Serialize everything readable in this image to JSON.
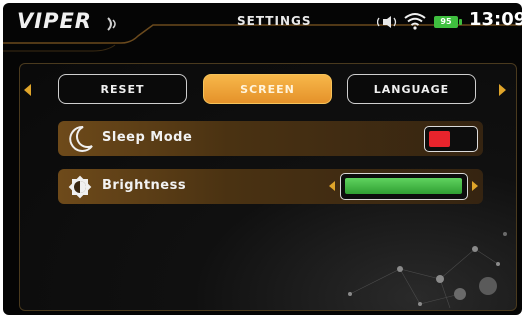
{
  "header": {
    "logo": "VIPER",
    "title": "SETTINGS",
    "status": {
      "speaker_icon": "speaker-volume-icon",
      "wifi_icon": "wifi-icon",
      "battery_level": "95",
      "battery_color": "#3fbf3f",
      "time": "13:09"
    }
  },
  "tabs": [
    {
      "label": "RESET",
      "active": false
    },
    {
      "label": "SCREEN",
      "active": true
    },
    {
      "label": "LANGUAGE",
      "active": false
    }
  ],
  "settings": {
    "sleep_mode": {
      "label": "Sleep Mode",
      "icon": "moon-icon",
      "toggle_color": "#e8242c"
    },
    "brightness": {
      "label": "Brightness",
      "icon": "brightness-icon",
      "level_fraction": 1.0,
      "fill_color": "#3fbf3f"
    }
  },
  "colors": {
    "accent": "#e0a52a",
    "active_tab": "#f2a23a"
  }
}
